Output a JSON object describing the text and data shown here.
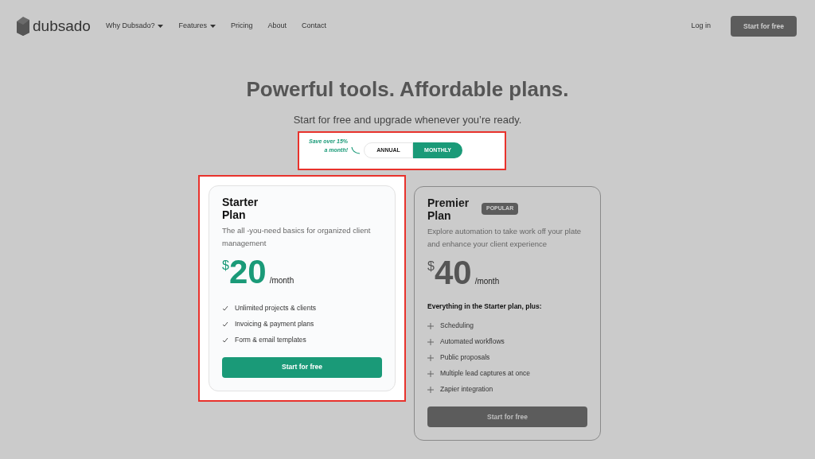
{
  "nav": {
    "logo": "dubsado",
    "links": [
      {
        "label": "Why Dubsado?",
        "dropdown": true
      },
      {
        "label": "Features",
        "dropdown": true
      },
      {
        "label": "Pricing",
        "dropdown": false
      },
      {
        "label": "About",
        "dropdown": false
      },
      {
        "label": "Contact",
        "dropdown": false
      }
    ],
    "login": "Log in",
    "cta": "Start for free"
  },
  "heading": "Powerful tools. Affordable plans.",
  "subheading": "Start for free and upgrade whenever you’re ready.",
  "billing": {
    "highlighted": true,
    "note": [
      "Save over 15%",
      "a month!"
    ],
    "options": [
      {
        "label": "ANNUAL",
        "selected": false
      },
      {
        "label": "MONTHLY",
        "selected": true
      }
    ]
  },
  "plans": [
    {
      "name": "Starter Plan",
      "highlighted": true,
      "description": "The all -you-need basics for organized client management",
      "currency": "$",
      "price": "20",
      "period": "/month",
      "kind": "check",
      "features": [
        "Unlimited projects & clients",
        "Invoicing & payment plans",
        "Form & email templates"
      ],
      "button": "Start for free"
    },
    {
      "name": "Premier Plan",
      "highlighted": false,
      "badge": "POPULAR",
      "description": "Explore automation to take work off your plate and enhance your client experience",
      "currency": "$",
      "price": "40",
      "period": "/month",
      "features_heading": "Everything in the Starter plan, plus:",
      "kind": "plus",
      "features": [
        "Scheduling",
        "Automated workflows",
        "Public proposals",
        "Multiple lead captures at once",
        "Zapier integration"
      ],
      "button": "Start for free"
    }
  ]
}
